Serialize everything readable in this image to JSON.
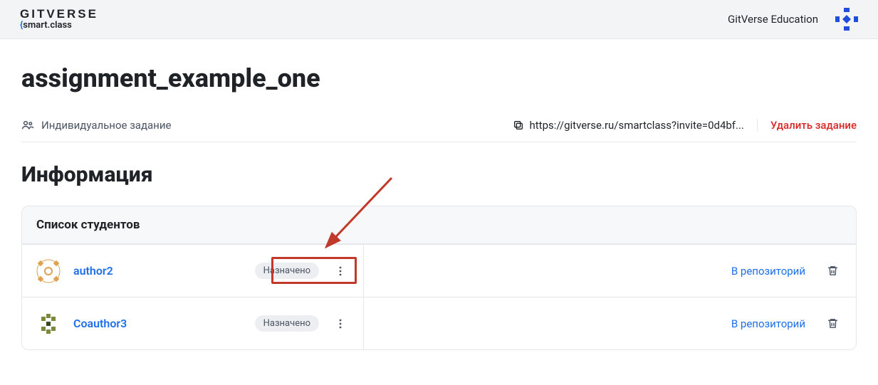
{
  "header": {
    "logo_main": "GITVERSE",
    "logo_sub_prefix": "{",
    "logo_sub": "smart.class",
    "nav_link": "GitVerse Education"
  },
  "page": {
    "title": "assignment_example_one",
    "task_type": "Индивидуальное задание",
    "invite_url": "https://gitverse.ru/smartclass?invite=0d4bf...",
    "delete_label": "Удалить задание",
    "info_heading": "Информация",
    "students_heading": "Список студентов"
  },
  "students": [
    {
      "name": "author2",
      "status": "Назначено",
      "repo_label": "В репозиторий",
      "avatar_color": "#e0a050"
    },
    {
      "name": "Coauthor3",
      "status": "Назначено",
      "repo_label": "В репозиторий",
      "avatar_color": "#7a8a3a"
    }
  ]
}
